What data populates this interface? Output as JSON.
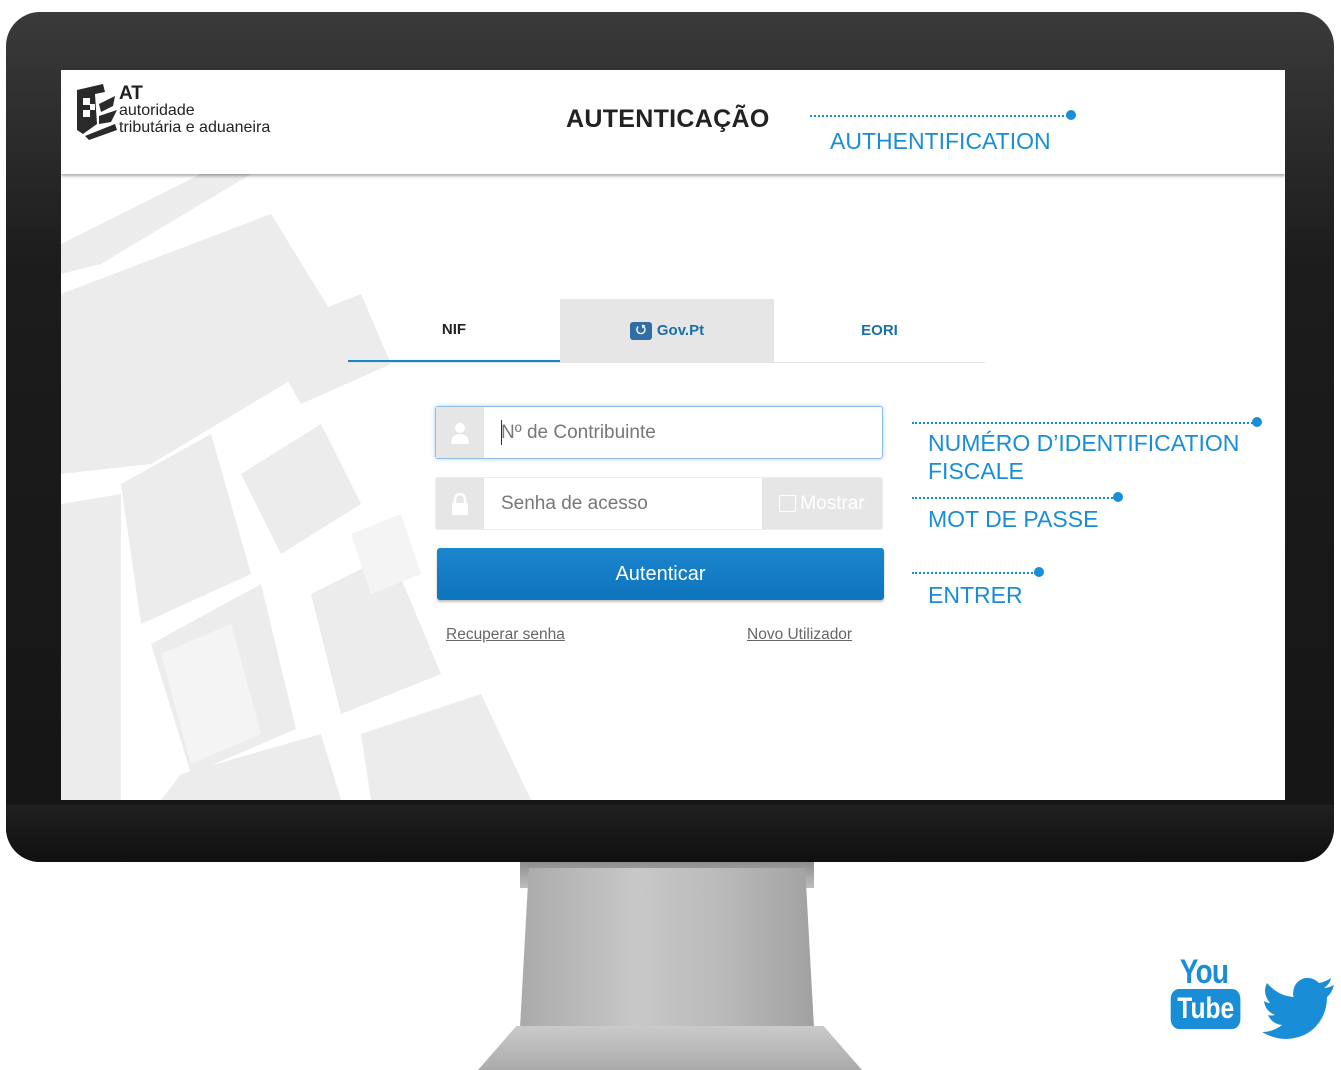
{
  "header": {
    "logo_title": "AT",
    "logo_line1": "autoridade",
    "logo_line2": "tributária e aduaneira",
    "page_title": "AUTENTICAÇÃO"
  },
  "tabs": [
    {
      "label": "NIF",
      "active": true
    },
    {
      "label": "Gov.Pt",
      "icon": "gov-pt-icon",
      "active": false
    },
    {
      "label": "EORI",
      "active": false
    }
  ],
  "form": {
    "nif_placeholder": "Nº de Contribuinte",
    "password_placeholder": "Senha de acesso",
    "show_label": "Mostrar",
    "submit_label": "Autenticar",
    "recover_label": "Recuperar senha",
    "new_user_label": "Novo Utilizador"
  },
  "annotations": {
    "title": "AUTHENTIFICATION",
    "nif_line1": "NUMÉRO D’IDENTIFICATION",
    "nif_line2": "FISCALE",
    "password": "MOT DE PASSE",
    "submit": "ENTRER"
  },
  "social": {
    "youtube_top": "You",
    "youtube_bottom": "Tube",
    "twitter_icon": "twitter-bird-icon"
  },
  "colors": {
    "accent": "#1a8dd7",
    "button": "#1178c2",
    "tab_link": "#1b6fa8"
  }
}
